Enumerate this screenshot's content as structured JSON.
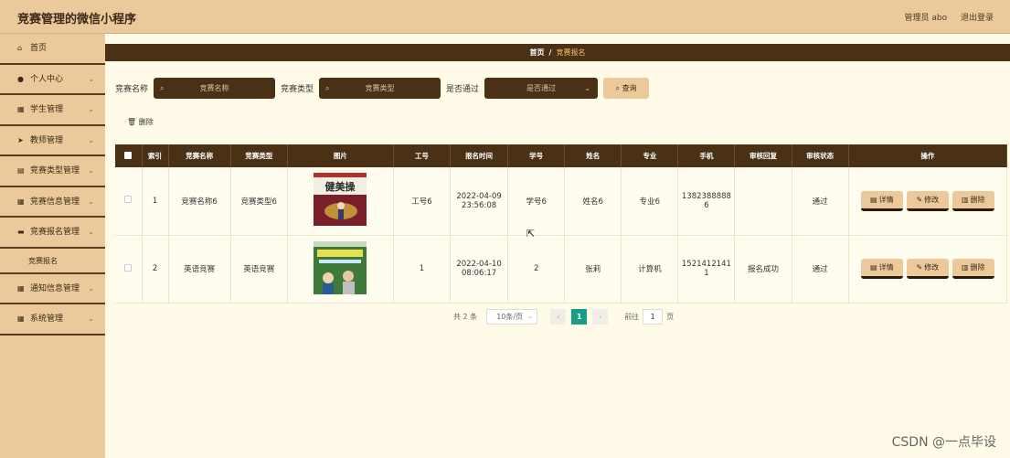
{
  "header": {
    "title": "竞赛管理的微信小程序",
    "user_label": "管理员 abo",
    "logout": "退出登录"
  },
  "sidebar": {
    "items": [
      {
        "label": "首页",
        "icon": "home-icon",
        "glyph": "⌂",
        "chevron": false
      },
      {
        "label": "个人中心",
        "icon": "person-icon",
        "glyph": "●",
        "chevron": true
      },
      {
        "label": "学生管理",
        "icon": "grid-icon",
        "glyph": "▦",
        "chevron": true
      },
      {
        "label": "教师管理",
        "icon": "send-icon",
        "glyph": "➤",
        "chevron": true
      },
      {
        "label": "竞赛类型管理",
        "icon": "list-icon",
        "glyph": "▤",
        "chevron": true
      },
      {
        "label": "竞赛信息管理",
        "icon": "grid-icon",
        "glyph": "▦",
        "chevron": true
      },
      {
        "label": "竞赛报名管理",
        "icon": "card-icon",
        "glyph": "▬",
        "chevron": true
      },
      {
        "label": "竞赛报名",
        "sub": true
      },
      {
        "label": "通知信息管理",
        "icon": "grid-icon",
        "glyph": "▦",
        "chevron": true
      },
      {
        "label": "系统管理",
        "icon": "grid-icon",
        "glyph": "▦",
        "chevron": true
      }
    ]
  },
  "breadcrumb": {
    "home": "首页",
    "separator": "/",
    "current": "竞赛报名"
  },
  "search": {
    "name_label": "竞赛名称",
    "name_placeholder": "竞赛名称",
    "type_label": "竞赛类型",
    "type_placeholder": "竞赛类型",
    "pass_label": "是否通过",
    "pass_placeholder": "是否通过",
    "query_button": "查询"
  },
  "actions": {
    "delete": "删除"
  },
  "table": {
    "headers": [
      "索引",
      "竞赛名称",
      "竞赛类型",
      "图片",
      "工号",
      "报名时间",
      "学号",
      "姓名",
      "专业",
      "手机",
      "审核回复",
      "审核状态",
      "操作"
    ],
    "rows": [
      {
        "index": "1",
        "name": "竞赛名称6",
        "type": "竞赛类型6",
        "image": "book-cover-fitness",
        "image_title": "健美操",
        "job_no": "工号6",
        "time_date": "2022-04-09",
        "time_clock": "23:56:08",
        "student_no": "学号6",
        "person": "姓名6",
        "major": "专业6",
        "phone_a": "1382388888",
        "phone_b": "6",
        "reply": "",
        "status": "通过"
      },
      {
        "index": "2",
        "name": "英语竞赛",
        "type": "英语竞赛",
        "image": "book-cover-english",
        "image_title": "",
        "job_no": "1",
        "time_date": "2022-04-10",
        "time_clock": "08:06:17",
        "student_no": "2",
        "person": "张莉",
        "major": "计算机",
        "phone_a": "1521412141",
        "phone_b": "1",
        "reply": "报名成功",
        "status": "通过"
      }
    ],
    "ops": {
      "detail": "详情",
      "edit": "修改",
      "delete": "删除"
    }
  },
  "pagination": {
    "total": "共 2 条",
    "page_size": "10条/页",
    "current": "1",
    "goto_label": "前往",
    "goto_value": "1",
    "page_suffix": "页"
  },
  "watermark": "CSDN @一点毕设",
  "colors": {
    "accent_dark": "#4a3115",
    "accent_light": "#ecc99b",
    "background": "#fffbe8",
    "page_active": "#1a9d87"
  }
}
